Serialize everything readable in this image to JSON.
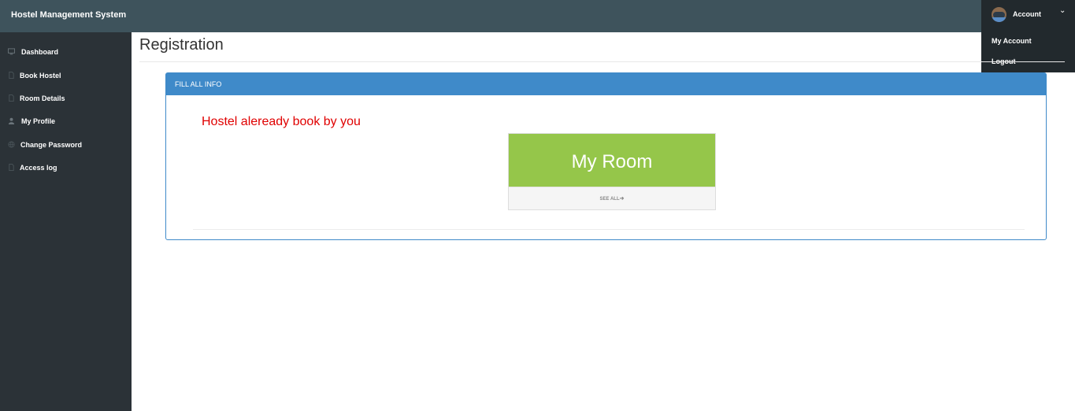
{
  "header": {
    "brand": "Hostel Management System",
    "account_label": "Account",
    "chevron_icon": "chevron-down-icon",
    "avatar_icon": "user-avatar-icon"
  },
  "account_menu": {
    "items": [
      {
        "label": "My Account"
      },
      {
        "label": "Logout"
      }
    ]
  },
  "sidebar": {
    "items": [
      {
        "label": "Dashboard",
        "icon": "desktop-icon"
      },
      {
        "label": "Book Hostel",
        "icon": "file-icon"
      },
      {
        "label": "Room Details",
        "icon": "file-icon"
      },
      {
        "label": "My Profile",
        "icon": "user-icon"
      },
      {
        "label": "Change Password",
        "icon": "globe-icon"
      },
      {
        "label": "Access log",
        "icon": "file-icon"
      }
    ]
  },
  "main": {
    "title": "Registration",
    "panel_heading": "FILL ALL INFO",
    "notice": "Hostel aleready book by you",
    "room_card": {
      "title": "My Room",
      "link_label": "SEE ALL",
      "link_icon": "arrow-right-icon"
    }
  },
  "colors": {
    "topbar": "#3e535c",
    "sidebar": "#2b3237",
    "panel_accent": "#3f8ac9",
    "room_card": "#95c64a",
    "notice": "#e00000"
  }
}
